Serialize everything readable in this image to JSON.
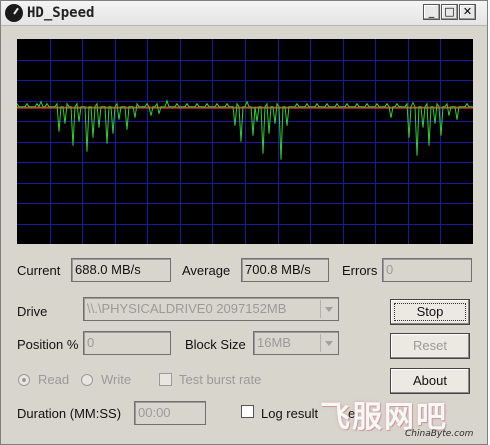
{
  "window": {
    "title": "HD_Speed",
    "minimize": "_",
    "maximize": "□",
    "close": "✕"
  },
  "graph": {
    "series": {
      "average_level": 0.335,
      "grid": true,
      "colors": {
        "background": "#000000",
        "grid": "#1a1aa0",
        "average": "#d04030",
        "speed": "#30d030"
      }
    }
  },
  "stats": {
    "current_label": "Current",
    "current_value": "688.0 MB/s",
    "average_label": "Average",
    "average_value": "700.8 MB/s",
    "errors_label": "Errors",
    "errors_value": "0"
  },
  "settings": {
    "drive_label": "Drive",
    "drive_value": "\\\\.\\PHYSICALDRIVE0    2097152MB",
    "position_label": "Position %",
    "position_value": "0",
    "block_size_label": "Block Size",
    "block_size_value": "16MB",
    "read_label": "Read",
    "write_label": "Write",
    "burst_label": "Test burst rate",
    "duration_label": "Duration (MM:SS)",
    "duration_value": "00:00",
    "log_label": "Log result",
    "log_suffix": "e"
  },
  "buttons": {
    "stop": "Stop",
    "reset": "Reset",
    "about": "About"
  },
  "watermark": {
    "text": "飞服网吧",
    "site": "ChinaByte.com"
  }
}
